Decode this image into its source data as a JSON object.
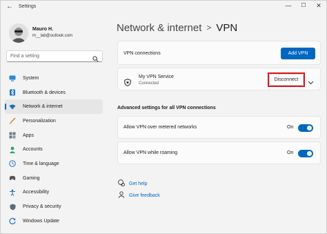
{
  "window": {
    "title": "Settings"
  },
  "user": {
    "name": "Mauro H.",
    "email": "m__lab@outlook.com"
  },
  "search": {
    "placeholder": "Find a setting"
  },
  "sidebar": {
    "items": [
      {
        "label": "System",
        "icon": "system-icon",
        "active": false
      },
      {
        "label": "Bluetooth & devices",
        "icon": "bluetooth-icon",
        "active": false
      },
      {
        "label": "Network & internet",
        "icon": "wifi-icon",
        "active": true
      },
      {
        "label": "Personalization",
        "icon": "brush-icon",
        "active": false
      },
      {
        "label": "Apps",
        "icon": "apps-icon",
        "active": false
      },
      {
        "label": "Accounts",
        "icon": "person-icon",
        "active": false
      },
      {
        "label": "Time & language",
        "icon": "globe-clock-icon",
        "active": false
      },
      {
        "label": "Gaming",
        "icon": "gamepad-icon",
        "active": false
      },
      {
        "label": "Accessibility",
        "icon": "accessibility-icon",
        "active": false
      },
      {
        "label": "Privacy & security",
        "icon": "shield-icon",
        "active": false
      },
      {
        "label": "Windows Update",
        "icon": "update-icon",
        "active": false
      }
    ]
  },
  "breadcrumb": {
    "parent": "Network & internet",
    "separator": ">",
    "current": "VPN"
  },
  "vpn_connections": {
    "label": "VPN connections",
    "add_button": "Add VPN"
  },
  "vpn_entry": {
    "name": "My VPN Service",
    "status": "Connected",
    "disconnect_button": "Disconnect"
  },
  "advanced": {
    "title": "Advanced settings for all VPN connections",
    "settings": [
      {
        "label": "Allow VPN over metered networks",
        "state": "On",
        "enabled": true
      },
      {
        "label": "Allow VPN while roaming",
        "state": "On",
        "enabled": true
      }
    ]
  },
  "links": {
    "help": "Get help",
    "feedback": "Give feedback"
  },
  "colors": {
    "accent": "#0067c0",
    "highlight": "#d9151b",
    "background": "#f3f3f3"
  }
}
